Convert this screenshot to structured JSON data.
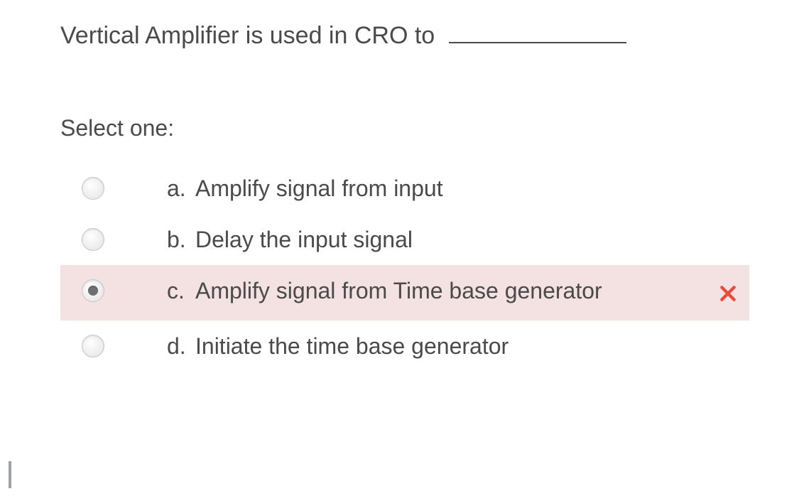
{
  "question": {
    "stem": "Vertical Amplifier is used in CRO to",
    "prompt": "Select one:"
  },
  "options": [
    {
      "letter": "a.",
      "text": "Amplify signal from input",
      "selected": false,
      "status": "none"
    },
    {
      "letter": "b.",
      "text": "Delay the input signal",
      "selected": false,
      "status": "none"
    },
    {
      "letter": "c.",
      "text": "Amplify signal from Time base generator",
      "selected": true,
      "status": "incorrect"
    },
    {
      "letter": "d.",
      "text": "Initiate the time base generator",
      "selected": false,
      "status": "none"
    }
  ],
  "colors": {
    "incorrect_bg": "#f4e1e1",
    "incorrect_mark": "#e84b3c"
  }
}
